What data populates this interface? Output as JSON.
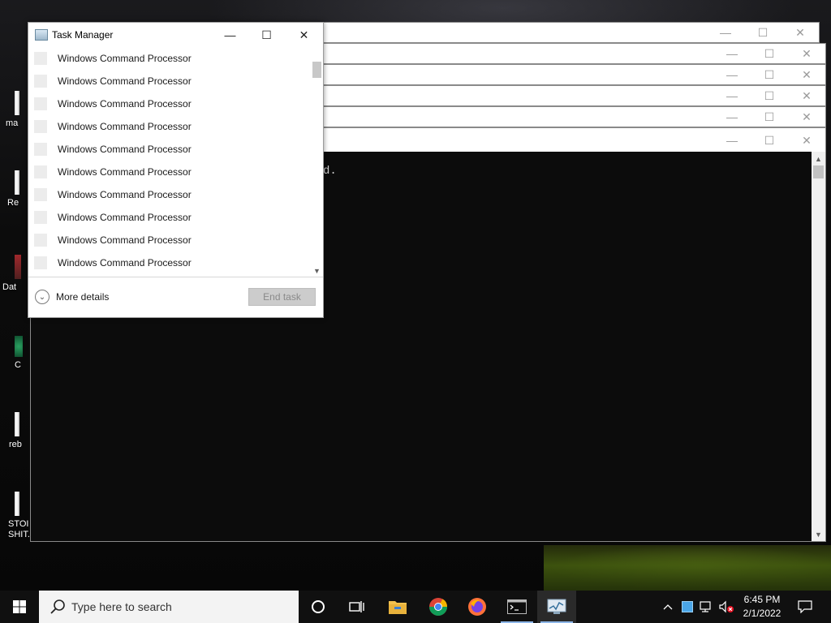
{
  "desktop": {
    "icons": [
      {
        "label": "ma",
        "style": "white"
      },
      {
        "label": "Re",
        "style": "white"
      },
      {
        "label": "Dat",
        "style": "red"
      },
      {
        "label": "C",
        "style": "green"
      },
      {
        "label": "reb",
        "style": "white"
      },
      {
        "label": "STOI SHIT.bat",
        "style": "white"
      }
    ]
  },
  "console": {
    "visible_text": "d.",
    "window_count": 6
  },
  "task_manager": {
    "title": "Task Manager",
    "minimize_glyph": "—",
    "maximize_glyph": "☐",
    "close_glyph": "✕",
    "processes": [
      "Windows Command Processor",
      "Windows Command Processor",
      "Windows Command Processor",
      "Windows Command Processor",
      "Windows Command Processor",
      "Windows Command Processor",
      "Windows Command Processor",
      "Windows Command Processor",
      "Windows Command Processor",
      "Windows Command Processor"
    ],
    "more_details_label": "More details",
    "end_task_label": "End task"
  },
  "taskbar": {
    "search_placeholder": "Type here to search",
    "pinned": [
      {
        "name": "cortana-icon"
      },
      {
        "name": "task-view-icon"
      },
      {
        "name": "file-explorer-icon"
      },
      {
        "name": "chrome-icon"
      },
      {
        "name": "firefox-icon"
      },
      {
        "name": "command-prompt-icon",
        "running": true
      },
      {
        "name": "task-manager-icon",
        "active": true
      }
    ],
    "clock_time": "6:45 PM",
    "clock_date": "2/1/2022"
  },
  "colors": {
    "taskbar_bg": "#101010",
    "accent_underline": "#8db6e8",
    "console_bg": "#0c0c0c"
  }
}
